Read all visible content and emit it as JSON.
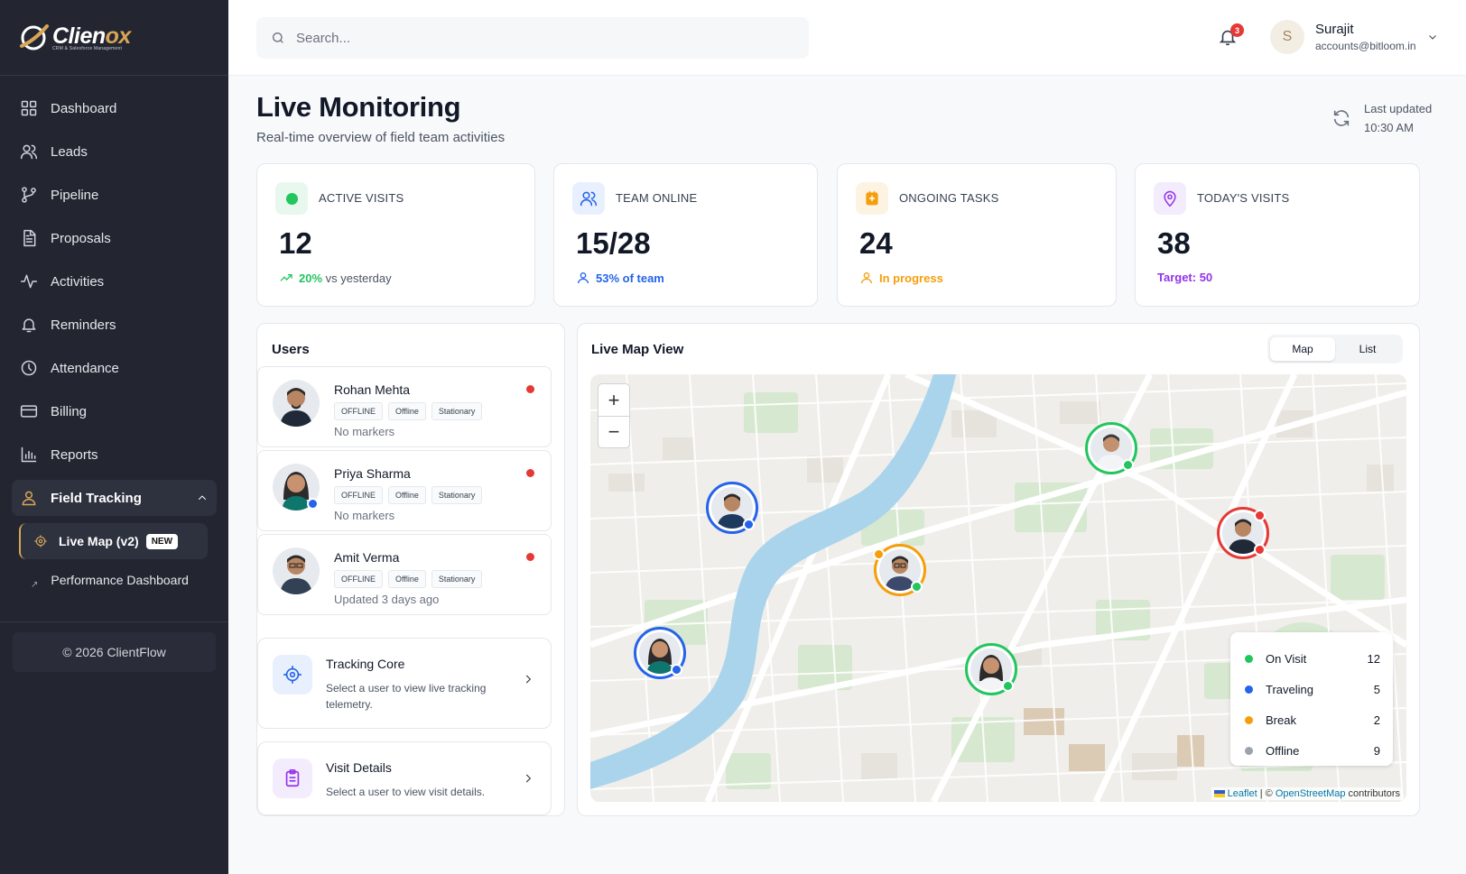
{
  "brand": {
    "name_main": "Clien",
    "name_accent": "ox",
    "tagline": "CRM & Salesforce Management"
  },
  "sidebar": {
    "items": [
      {
        "label": "Dashboard",
        "icon": "dashboard-icon"
      },
      {
        "label": "Leads",
        "icon": "users-icon"
      },
      {
        "label": "Pipeline",
        "icon": "pipeline-icon"
      },
      {
        "label": "Proposals",
        "icon": "document-icon"
      },
      {
        "label": "Activities",
        "icon": "activity-icon"
      },
      {
        "label": "Reminders",
        "icon": "bell-icon"
      },
      {
        "label": "Attendance",
        "icon": "clock-icon"
      },
      {
        "label": "Billing",
        "icon": "card-icon"
      },
      {
        "label": "Reports",
        "icon": "bar-chart-icon"
      }
    ],
    "group": {
      "label": "Field Tracking",
      "icon": "user-location-icon"
    },
    "subitems": [
      {
        "label": "Live Map (v2)",
        "badge": "NEW",
        "icon": "target-icon"
      },
      {
        "label": "Performance Dashboard",
        "icon": "arrow-icon"
      }
    ],
    "copyright": "© 2026 ClientFlow"
  },
  "topbar": {
    "search_placeholder": "Search...",
    "notification_count": "3",
    "user": {
      "initial": "S",
      "name": "Surajit",
      "email": "accounts@bitloom.in"
    }
  },
  "page": {
    "title": "Live Monitoring",
    "subtitle": "Real-time overview of field team activities",
    "last_updated_label": "Last updated",
    "last_updated_time": "10:30 AM"
  },
  "stats": [
    {
      "label": "ACTIVE VISITS",
      "value": "12",
      "foot_value": "20%",
      "foot_text": " vs yesterday",
      "color": "#22c55e"
    },
    {
      "label": "TEAM ONLINE",
      "value": "15/28",
      "foot_value": "53% of team",
      "foot_text": "",
      "color": "#2563eb"
    },
    {
      "label": "ONGOING TASKS",
      "value": "24",
      "foot_value": "In progress",
      "foot_text": "",
      "color": "#f59e0b"
    },
    {
      "label": "TODAY'S VISITS",
      "value": "38",
      "foot_value": "Target: 50",
      "foot_text": "",
      "color": "#9333ea"
    }
  ],
  "users_panel": {
    "title": "Users",
    "users": [
      {
        "name": "Rohan Mehta",
        "tags": [
          "OFFLINE",
          "Offline",
          "Stationary"
        ],
        "note": "No markers"
      },
      {
        "name": "Priya Sharma",
        "tags": [
          "OFFLINE",
          "Offline",
          "Stationary"
        ],
        "note": "No markers"
      },
      {
        "name": "Amit Verma",
        "tags": [
          "OFFLINE",
          "Offline",
          "Stationary"
        ],
        "note": "Updated 3 days ago"
      }
    ]
  },
  "tracking_core": {
    "title": "Tracking Core",
    "desc": "Select a user to view live tracking telemetry."
  },
  "visit_details": {
    "title": "Visit Details",
    "desc": "Select a user to view visit details."
  },
  "map_panel": {
    "title": "Live Map View",
    "toggle": [
      "Map",
      "List"
    ],
    "zoom_in": "+",
    "zoom_out": "−",
    "legend": [
      {
        "label": "On Visit",
        "count": "12",
        "color": "#22c55e"
      },
      {
        "label": "Traveling",
        "count": "5",
        "color": "#2563eb"
      },
      {
        "label": "Break",
        "count": "2",
        "color": "#f59e0b"
      },
      {
        "label": "Offline",
        "count": "9",
        "color": "#9ca3af"
      }
    ],
    "attribution": {
      "leaflet": "Leaflet",
      "sep": " | © ",
      "osm": "OpenStreetMap",
      "suffix": " contributors"
    }
  }
}
